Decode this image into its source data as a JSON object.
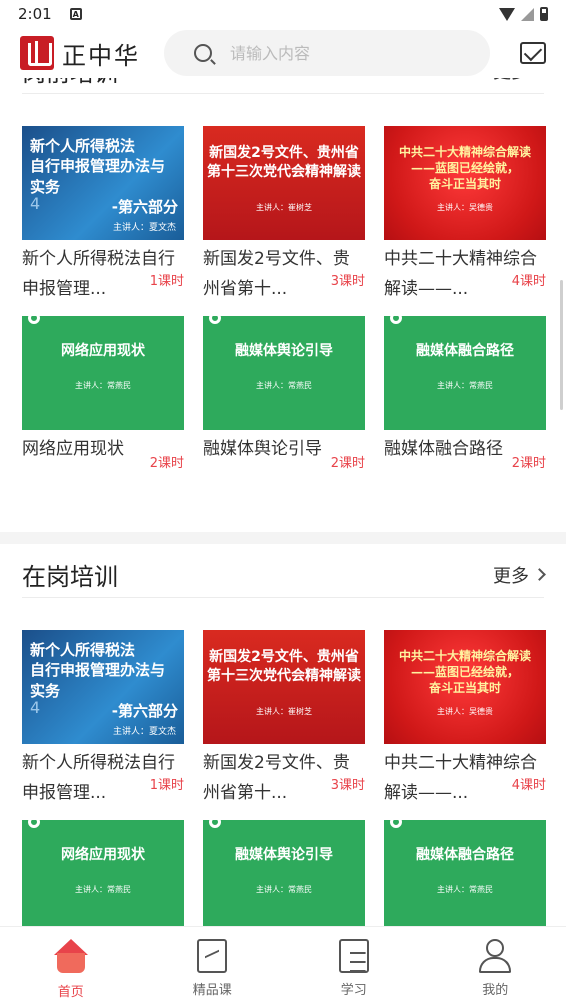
{
  "status_bar": {
    "time": "2:01",
    "notif_letter": "A"
  },
  "header": {
    "logo_text": "正中华",
    "search_placeholder": "请输入内容"
  },
  "sections": [
    {
      "title": "岗前培训",
      "more": "更多",
      "courses": [
        {
          "title": "新个人所得税法自行申报管理...",
          "lessons": "1课时",
          "thumb_lines": [
            "新个人所得税法",
            "自行申报管理办法与实务",
            "-第六部分"
          ],
          "thumb_num": "4",
          "thumb_speaker": "主讲人：夏文杰",
          "style": "blue"
        },
        {
          "title": "新国发2号文件、贵州省第十...",
          "lessons": "3课时",
          "thumb_lines": [
            "新国发2号文件、贵州省",
            "第十三次党代会精神解读"
          ],
          "thumb_speaker": "主讲人：崔树芝",
          "style": "red"
        },
        {
          "title": "中共二十大精神综合解读——...",
          "lessons": "4课时",
          "thumb_lines": [
            "中共二十大精神综合解读",
            "——蓝图已经绘就，",
            "奋斗正当其时"
          ],
          "thumb_speaker": "主讲人：吴德贵",
          "style": "crimson"
        },
        {
          "title": "网络应用现状",
          "lessons": "2课时",
          "thumb_lines": [
            "网络应用现状"
          ],
          "thumb_speaker": "主讲人：常燕民",
          "style": "green"
        },
        {
          "title": "融媒体舆论引导",
          "lessons": "2课时",
          "thumb_lines": [
            "融媒体舆论引导"
          ],
          "thumb_speaker": "主讲人：常燕民",
          "style": "green"
        },
        {
          "title": "融媒体融合路径",
          "lessons": "2课时",
          "thumb_lines": [
            "融媒体融合路径"
          ],
          "thumb_speaker": "主讲人：常燕民",
          "style": "green"
        }
      ]
    },
    {
      "title": "在岗培训",
      "more": "更多",
      "courses": [
        {
          "title": "新个人所得税法自行申报管理...",
          "lessons": "1课时",
          "thumb_lines": [
            "新个人所得税法",
            "自行申报管理办法与实务",
            "-第六部分"
          ],
          "thumb_num": "4",
          "thumb_speaker": "主讲人：夏文杰",
          "style": "blue"
        },
        {
          "title": "新国发2号文件、贵州省第十...",
          "lessons": "3课时",
          "thumb_lines": [
            "新国发2号文件、贵州省",
            "第十三次党代会精神解读"
          ],
          "thumb_speaker": "主讲人：崔树芝",
          "style": "red"
        },
        {
          "title": "中共二十大精神综合解读——...",
          "lessons": "4课时",
          "thumb_lines": [
            "中共二十大精神综合解读",
            "——蓝图已经绘就，",
            "奋斗正当其时"
          ],
          "thumb_speaker": "主讲人：吴德贵",
          "style": "crimson"
        },
        {
          "title": "",
          "lessons": "",
          "thumb_lines": [
            "网络应用现状"
          ],
          "thumb_speaker": "主讲人：常燕民",
          "style": "green"
        },
        {
          "title": "",
          "lessons": "",
          "thumb_lines": [
            "融媒体舆论引导"
          ],
          "thumb_speaker": "主讲人：常燕民",
          "style": "green"
        },
        {
          "title": "",
          "lessons": "",
          "thumb_lines": [
            "融媒体融合路径"
          ],
          "thumb_speaker": "主讲人：常燕民",
          "style": "green"
        }
      ]
    }
  ],
  "tabbar": [
    {
      "label": "首页",
      "icon": "home-icon",
      "active": true
    },
    {
      "label": "精品课",
      "icon": "course-icon",
      "active": false
    },
    {
      "label": "学习",
      "icon": "study-icon",
      "active": false
    },
    {
      "label": "我的",
      "icon": "me-icon",
      "active": false
    }
  ],
  "colors": {
    "accent": "#e8434a",
    "brand": "#c81d25",
    "green_thumb": "#2eaa5c",
    "blue_thumb": "#1e6fae"
  }
}
